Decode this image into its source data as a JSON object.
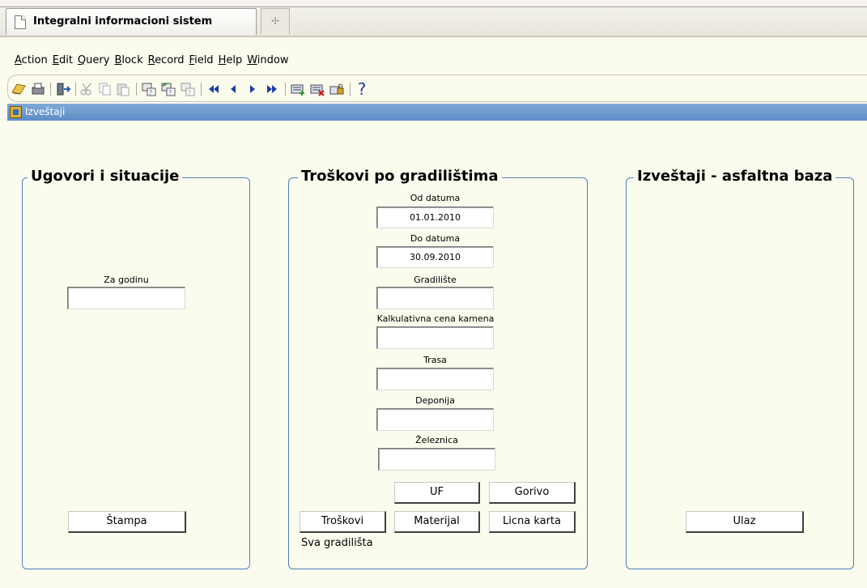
{
  "browser": {
    "tab_title": "Integralni informacioni sistem",
    "new_tab_glyph": "✢"
  },
  "menu": [
    {
      "label": "Action",
      "name": "menu-action"
    },
    {
      "label": "Edit",
      "name": "menu-edit"
    },
    {
      "label": "Query",
      "name": "menu-query"
    },
    {
      "label": "Block",
      "name": "menu-block"
    },
    {
      "label": "Record",
      "name": "menu-record"
    },
    {
      "label": "Field",
      "name": "menu-field"
    },
    {
      "label": "Help",
      "name": "menu-help"
    },
    {
      "label": "Window",
      "name": "menu-window"
    }
  ],
  "toolbar": {
    "icons": [
      "save-icon",
      "print-icon",
      "exit-icon",
      "cut-icon",
      "copy-icon",
      "paste-icon",
      "enter-query-icon",
      "execute-query-icon",
      "cancel-query-icon",
      "previous-block-icon",
      "previous-record-icon",
      "next-record-icon",
      "next-block-icon",
      "insert-record-icon",
      "delete-record-icon",
      "lock-record-icon",
      "help-icon"
    ],
    "help_glyph": "?"
  },
  "form": {
    "title": "Izveštaji"
  },
  "panel_ugovori": {
    "title": "Ugovori i situacije",
    "za_godinu_label": "Za godinu",
    "za_godinu_value": "",
    "stampa_label": "Štampa"
  },
  "panel_troskovi": {
    "title": "Troškovi po gradilištima",
    "od_datuma_label": "Od datuma",
    "od_datuma_value": "01.01.2010",
    "do_datuma_label": "Do datuma",
    "do_datuma_value": "30.09.2010",
    "gradiliste_label": "Gradilište",
    "gradiliste_value": "",
    "kalkulativna_label": "Kalkulativna cena kamena",
    "kalkulativna_value": "",
    "trasa_label": "Trasa",
    "trasa_value": "",
    "deponija_label": "Deponija",
    "deponija_value": "",
    "zeleznica_label": "Železnica",
    "zeleznica_value": "",
    "uf_label": "UF",
    "gorivo_label": "Gorivo",
    "troskovi_label": "Troškovi",
    "materijal_label": "Materijal",
    "licna_karta_label": "Licna karta",
    "sva_gradilista_text": "Sva gradilišta"
  },
  "panel_asfalt": {
    "title": "Izveštaji - asfaltna baza",
    "ulaz_label": "Ulaz"
  },
  "colors": {
    "background": "#fbfbee",
    "form_title_bar": "#6b98cc",
    "panel_border": "#4f7fbf"
  }
}
